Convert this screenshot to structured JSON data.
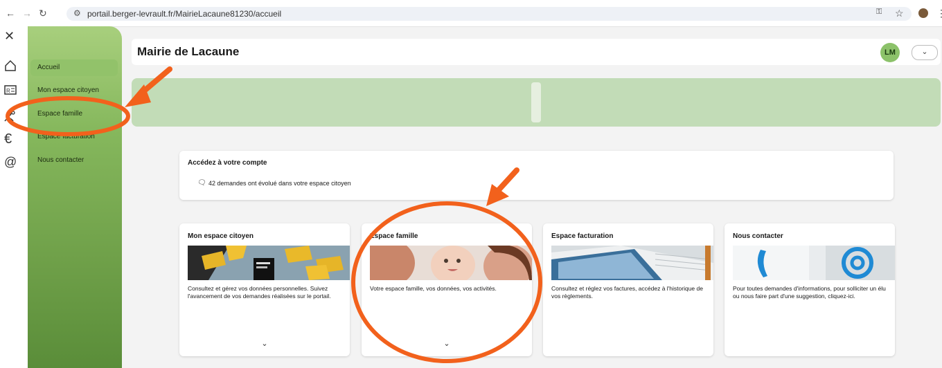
{
  "browser": {
    "url": "portail.berger-levrault.fr/MairieLacaune81230/accueil"
  },
  "sidebar": {
    "close_glyph": "✕",
    "items": [
      {
        "label": "Accueil",
        "icon": "home-icon",
        "active": true
      },
      {
        "label": "Mon espace citoyen",
        "icon": "id-card-icon",
        "active": false
      },
      {
        "label": "Espace famille",
        "icon": "family-icon",
        "active": false
      },
      {
        "label": "Espace facturation",
        "icon": "euro-icon",
        "active": false
      },
      {
        "label": "Nous contacter",
        "icon": "at-icon",
        "active": false
      }
    ]
  },
  "header": {
    "title": "Mairie de Lacaune",
    "avatar": "LM",
    "dropdown_glyph": "⌄"
  },
  "account": {
    "title": "Accédez à votre compte",
    "message": "42 demandes ont évolué dans votre espace citoyen"
  },
  "cards": [
    {
      "title": "Mon espace citoyen",
      "description": "Consultez et gérez vos données personnelles. Suivez l'avancement de vos demandes réalisées sur le portail.",
      "expand": "⌄",
      "image": "envelopes-laptop"
    },
    {
      "title": "Espace famille",
      "description": "Votre espace famille, vos données, vos activités.",
      "expand": "⌄",
      "image": "family-baby"
    },
    {
      "title": "Espace facturation",
      "description": "Consultez et réglez vos factures, accédez à l'historique de vos règlements.",
      "expand": "",
      "image": "invoice-tablet"
    },
    {
      "title": "Nous contacter",
      "description": "Pour toutes demandes d'informations, pour solliciter un élu ou nous faire part d'une suggestion, cliquez-ici.",
      "expand": "",
      "image": "phone-at"
    }
  ],
  "colors": {
    "sidebar_green": "#86b85d",
    "banner_green": "#c2dcb7",
    "annotation_orange": "#f2611c"
  }
}
